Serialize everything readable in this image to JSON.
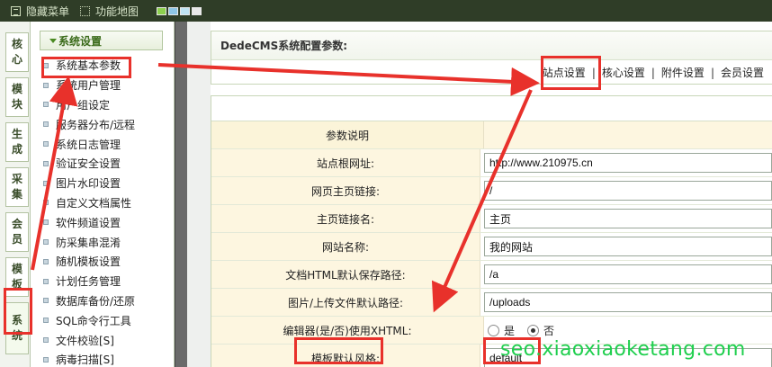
{
  "topbar": {
    "hide_menu": "隐藏菜单",
    "site_map": "功能地图",
    "swatch_colors": [
      "#8dd04e",
      "#8ec6e6",
      "#bfe3f3",
      "#e8e8e8"
    ]
  },
  "vtabs": [
    "核心",
    "模块",
    "生成",
    "采集",
    "会员",
    "模板",
    "系统"
  ],
  "menu": {
    "header": "系统设置",
    "items": [
      "系统基本参数",
      "系统用户管理",
      "用户组设定",
      "服务器分布/远程",
      "系统日志管理",
      "验证安全设置",
      "图片水印设置",
      "自定义文档属性",
      "软件频道设置",
      "防采集串混淆",
      "随机模板设置",
      "计划任务管理",
      "数据库备份/还原",
      "SQL命令行工具",
      "文件校验[S]",
      "病毒扫描[S]"
    ]
  },
  "main": {
    "title": "DedeCMS系统配置参数:",
    "links": [
      "站点设置",
      "核心设置",
      "附件设置",
      "会员设置"
    ],
    "header_label": "参数说明",
    "rows": [
      {
        "label": "站点根网址:",
        "value": "http://www.210975.cn"
      },
      {
        "label": "网页主页链接:",
        "value": "/"
      },
      {
        "label": "主页链接名:",
        "value": "主页"
      },
      {
        "label": "网站名称:",
        "value": "我的网站"
      },
      {
        "label": "文档HTML默认保存路径:",
        "value": "/a"
      },
      {
        "label": "图片/上传文件默认路径:",
        "value": "/uploads"
      }
    ],
    "xhtml_row": {
      "label": "编辑器(是/否)使用XHTML:",
      "yes": "是",
      "no": "否",
      "selected": "否"
    },
    "style_row": {
      "label": "模板默认风格:",
      "value": "default"
    }
  },
  "annotation_color": "#e8312b",
  "watermark": "seo.xiaoxiaoketang.com"
}
